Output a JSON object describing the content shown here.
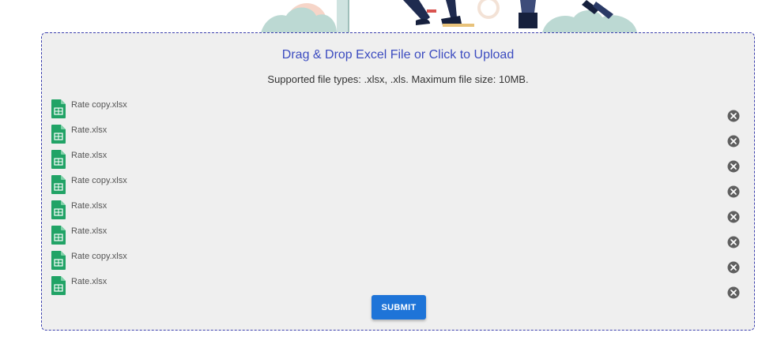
{
  "upload": {
    "title": "Drag & Drop Excel File or Click to Upload",
    "subtitle": "Supported file types: .xlsx, .xls. Maximum file size: 10MB.",
    "submit_label": "SUBMIT"
  },
  "files": [
    {
      "name": "Rate copy.xlsx"
    },
    {
      "name": "Rate.xlsx"
    },
    {
      "name": "Rate.xlsx"
    },
    {
      "name": "Rate copy.xlsx"
    },
    {
      "name": "Rate.xlsx"
    },
    {
      "name": "Rate.xlsx"
    },
    {
      "name": "Rate copy.xlsx"
    },
    {
      "name": "Rate.xlsx"
    }
  ],
  "icons": {
    "file": "spreadsheet-file-icon",
    "remove": "close-circle-icon",
    "header": "upload-illustration"
  },
  "colors": {
    "accent": "#3c4cc0",
    "border": "#3b3fae",
    "submit": "#1e74d8",
    "file_icon": "#21a366",
    "remove_icon": "#5f5f5f"
  }
}
